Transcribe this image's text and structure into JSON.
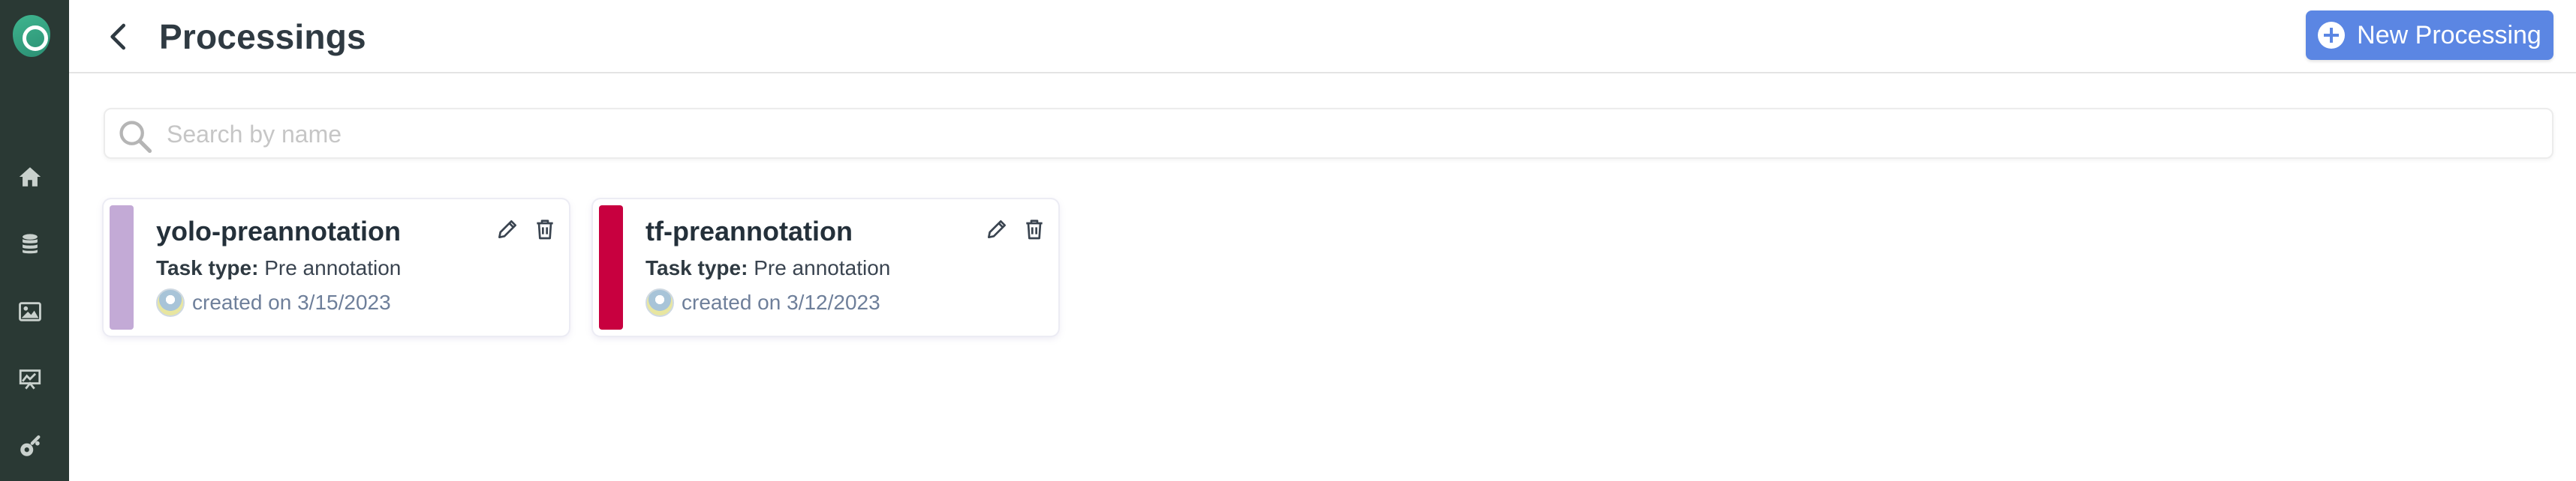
{
  "header": {
    "title": "Processings",
    "new_button_label": "New Processing"
  },
  "search": {
    "placeholder": "Search by name",
    "value": ""
  },
  "sidebar": {
    "items": [
      {
        "icon": "home-icon"
      },
      {
        "icon": "database-icon"
      },
      {
        "icon": "image-icon"
      },
      {
        "icon": "chart-icon"
      },
      {
        "icon": "processing-icon"
      }
    ]
  },
  "cards": [
    {
      "name": "yolo-preannotation",
      "task_type_label": "Task type:",
      "task_type": "Pre annotation",
      "created": "created on 3/15/2023",
      "color": "#c3aad6"
    },
    {
      "name": "tf-preannotation",
      "task_type_label": "Task type:",
      "task_type": "Pre annotation",
      "created": "created on 3/12/2023",
      "color": "#c8003f"
    }
  ],
  "colors": {
    "accent": "#5b86e3",
    "sidebar": "#2a3934"
  }
}
